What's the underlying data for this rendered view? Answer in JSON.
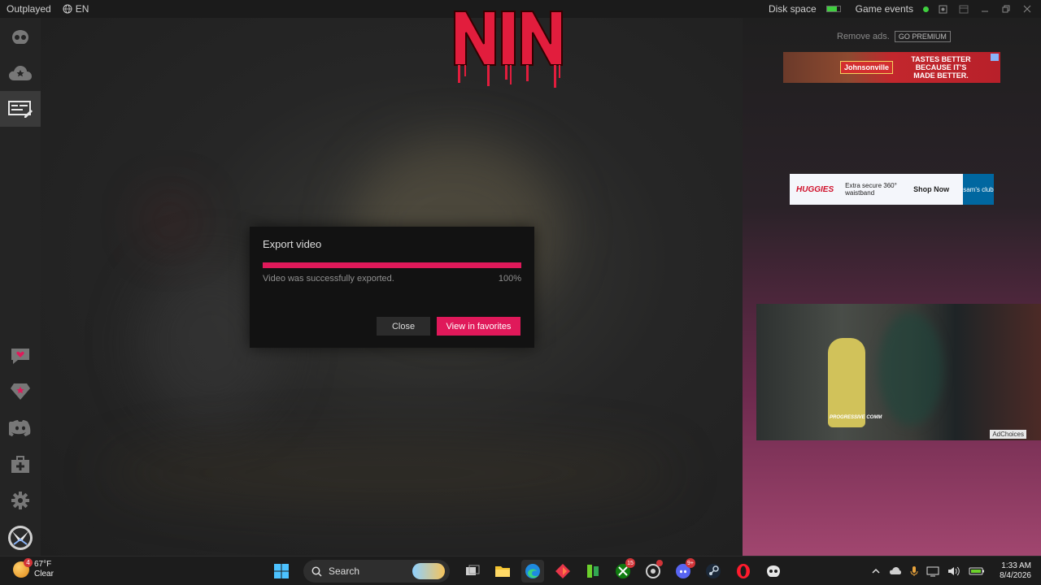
{
  "titlebar": {
    "app_name": "Outplayed",
    "language": "EN",
    "disk_space_label": "Disk space",
    "disk_space_fill": 0.8,
    "game_events_label": "Game events",
    "game_events_status_color": "#3fcf3f"
  },
  "sidebar": {
    "items": [
      {
        "icon": "outplayed-logo-icon",
        "active": false
      },
      {
        "icon": "cloud-star-icon",
        "active": false
      },
      {
        "icon": "video-editor-icon",
        "active": true
      },
      {
        "icon": "heart-chat-icon",
        "active": false
      },
      {
        "icon": "premium-gem-icon",
        "active": false
      },
      {
        "icon": "discord-icon",
        "active": false
      },
      {
        "icon": "medkit-icon",
        "active": false
      },
      {
        "icon": "gear-icon",
        "active": false
      },
      {
        "icon": "profile-avatar-icon",
        "active": false
      }
    ]
  },
  "modal": {
    "title": "Export video",
    "progress": 1.0,
    "status": "Video was successfully exported.",
    "percent": "100%",
    "close_label": "Close",
    "favorites_label": "View in favorites",
    "accent_color": "#e0195a"
  },
  "ads": {
    "remove_ads": "Remove ads.",
    "go_premium": "GO PREMIUM",
    "ad1": {
      "brand": "Johnsonville",
      "slogan": "TASTES BETTER BECAUSE IT'S MADE BETTER."
    },
    "ad2": {
      "brand": "HUGGIES",
      "copy": "Extra secure 360° waistband",
      "shop": "Shop Now",
      "club": "sam's club"
    },
    "video_caption": "PROGRESSIVE COMM",
    "adchoices": "AdChoices"
  },
  "taskbar": {
    "weather_badge": "4",
    "temperature": "67°F",
    "condition": "Clear",
    "search_label": "Search",
    "xbox_badge": "15",
    "discord_badge": "9+",
    "time": "1:33 AM",
    "date": "8/4/2026"
  }
}
